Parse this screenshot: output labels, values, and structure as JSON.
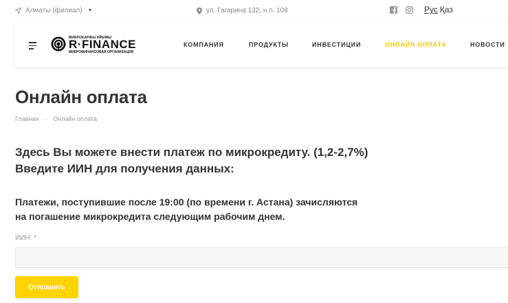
{
  "topbar": {
    "city": "Алматы (филиал)",
    "address": "ул. Гагарина 132, н.п. 108",
    "socials": [
      "facebook-icon",
      "instagram-icon"
    ],
    "languages": [
      {
        "label": "Рус",
        "active": true
      },
      {
        "label": "Қаз",
        "active": false
      }
    ]
  },
  "logo": {
    "top_text": "МИКРОКАРЖЫ ҰЙЫМЫ",
    "name": "R·FINANCE",
    "sub_text": "МИКРОФИНАНСОВАЯ ОРГАНИЗАЦИЯ"
  },
  "nav": {
    "items": [
      {
        "label": "КОМПАНИЯ",
        "active": false
      },
      {
        "label": "ПРОДУКТЫ",
        "active": false
      },
      {
        "label": "ИНВЕСТИЦИИ",
        "active": false
      },
      {
        "label": "ОНЛАЙН ОПЛАТА",
        "active": true
      },
      {
        "label": "НОВОСТИ",
        "active": false
      }
    ]
  },
  "page": {
    "title": "Онлайн оплата",
    "breadcrumb": [
      "Главная",
      "Онлайн оплата"
    ],
    "intro_line1": "Здесь Вы можете внести платеж по микрокредиту. (1,2-2,7%)",
    "intro_line2": "Введите ИИН для получения данных:",
    "note_line1": "Платежи, поступившие после 19:00 (по времени г. Астана) зачисляются",
    "note_line2": "на погашение микрокредита следующим рабочим днем."
  },
  "form": {
    "iin_label": "ИИН: *",
    "iin_value": "",
    "submit_label": "Отправить"
  },
  "colors": {
    "accent": "#ffd300",
    "nav_active": "#f8c700",
    "text": "#333333",
    "muted": "#999999"
  }
}
